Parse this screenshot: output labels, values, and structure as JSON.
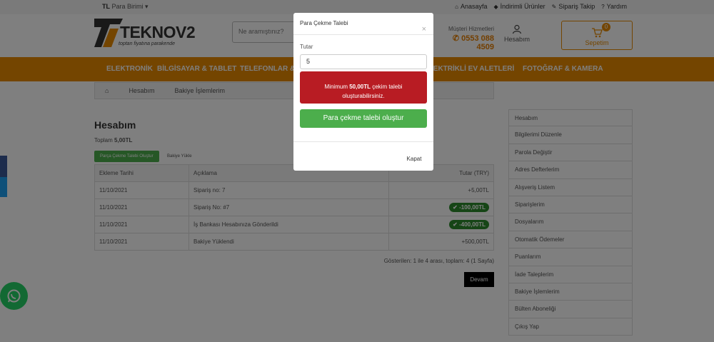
{
  "topbar": {
    "currency_code": "TL",
    "currency_label": "Para Birimi",
    "links": [
      "Anasayfa",
      "İndirimli Ürünler",
      "Sipariş Takip",
      "Yardım"
    ]
  },
  "header": {
    "logo_text": "TEKNOV2",
    "logo_tagline": "toptan fiyatına parakende",
    "search_placeholder": "Ne aramıştınız?",
    "support_label": "Müşteri Hizmetleri",
    "support_phone": "0553 088 4509",
    "account_label": "Hesabım",
    "cart_label": "Sepetim",
    "cart_count": "0"
  },
  "nav": [
    "ELEKTRONİK",
    "BİLGİSAYAR & TABLET",
    "TELEFONLAR &",
    "ELEKTRİKLİ EV ALETLERİ",
    "FOTOĞRAF & KAMERA"
  ],
  "breadcrumb": [
    "Hesabım",
    "Bakiye İşlemlerim"
  ],
  "page": {
    "title": "Hesabım",
    "total_label": "Toplam",
    "total_value": "5,00TL",
    "btn_withdraw": "Parça Çekme Talebi Oluştur",
    "btn_load": "Bakiye Yükle",
    "columns": [
      "Ekleme Tarihi",
      "Açıklama",
      "Tutar (TRY)"
    ],
    "rows": [
      {
        "date": "11/10/2021",
        "desc": "Sipariş no: 7",
        "amount": "+5,00TL",
        "badge": false
      },
      {
        "date": "11/10/2021",
        "desc": "Sipariş No: #7",
        "amount": "-100,00TL",
        "badge": true
      },
      {
        "date": "11/10/2021",
        "desc": "İş Bankası Hesabınıza Gönderildi",
        "amount": "-400,00TL",
        "badge": true
      },
      {
        "date": "11/10/2021",
        "desc": "Bakiye Yüklendi",
        "amount": "+500,00TL",
        "badge": false
      }
    ],
    "shown_text": "Gösterilen: 1 ile 4 arası, toplam: 4 (1 Sayfa)",
    "next_label": "Devam"
  },
  "sidebar": [
    "Hesabım",
    "Bilgilerimi Düzenle",
    "Parola Değiştir",
    "Adres Defterlerim",
    "Alışveriş Listem",
    "Siparişlerim",
    "Dosyalarım",
    "Otomatik Ödemeler",
    "Puanlarım",
    "İade Taleplerim",
    "Bakiye İşlemlerim",
    "Bülten Aboneliği",
    "Çıkış Yap"
  ],
  "modal": {
    "title": "Para Çekme Talebi",
    "close_glyph": "×",
    "amount_label": "Tutar",
    "amount_value": "5",
    "alert_prefix": "Minimum ",
    "alert_amount": "50,00TL",
    "alert_suffix": " çekim talebi oluşturabilirsiniz.",
    "submit_label": "Para çekme talebi oluştur",
    "close_label": "Kapat"
  },
  "colors": {
    "brand_orange": "#e88b00",
    "success_green": "#4cae4c",
    "alert_red": "#b81c23"
  }
}
